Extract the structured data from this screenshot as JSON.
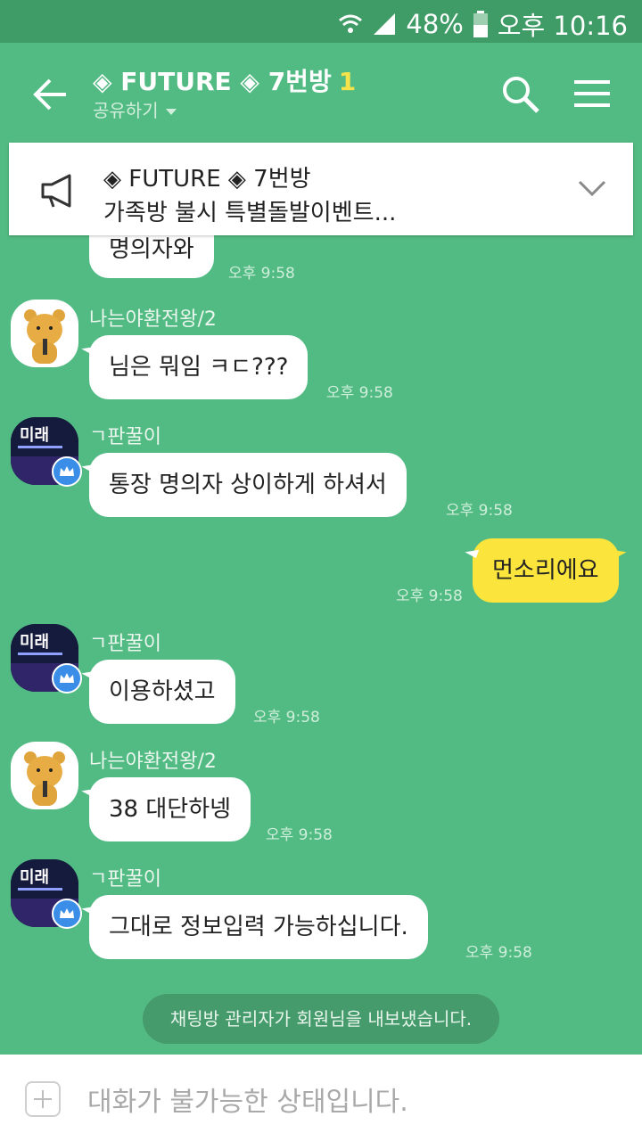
{
  "status_bar": {
    "battery": "48%",
    "time": "오후 10:16"
  },
  "header": {
    "title": "◈ FUTURE ◈ 7번방",
    "member_count": "1",
    "subtitle": "공유하기"
  },
  "notice": {
    "line1": "◈ FUTURE ◈ 7번방",
    "line2": "가족방 불시 특별돌발이벤트..."
  },
  "messages": [
    {
      "sender": "",
      "text": "명의자와",
      "time": "오후 9:58"
    },
    {
      "sender": "나는야환전왕/2",
      "text": "님은 뭐임 ㅋㄷ???",
      "time": "오후 9:58"
    },
    {
      "sender": "ㄱ판꿀이",
      "text": "통장 명의자 상이하게 하셔서",
      "time": "오후 9:58"
    },
    {
      "sender": "me",
      "text": "먼소리에요",
      "time": "오후 9:58"
    },
    {
      "sender": "ㄱ판꿀이",
      "text": "이용하셨고",
      "time": "오후 9:58"
    },
    {
      "sender": "나는야환전왕/2",
      "text": "38 대단하넹",
      "time": "오후 9:58"
    },
    {
      "sender": "ㄱ판꿀이",
      "text": "그대로 정보입력 가능하십니다.",
      "time": "오후 9:58"
    }
  ],
  "avatar_label": "미래",
  "system_message": "채팅방 관리자가 회원님을 내보냈습니다.",
  "input": {
    "placeholder": "대화가 불가능한 상태입니다."
  },
  "colors": {
    "background": "#52bb83",
    "my_bubble": "#fbe43c",
    "accent_count": "#f6e24a"
  }
}
